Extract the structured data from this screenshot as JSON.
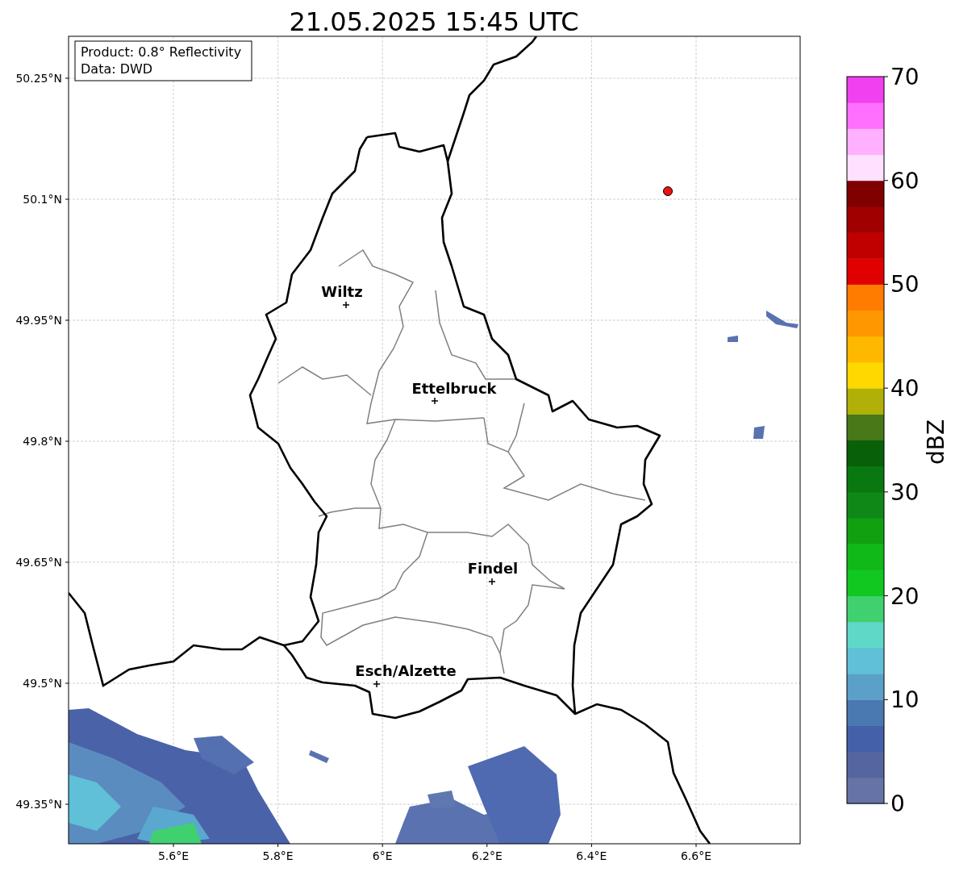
{
  "title": "21.05.2025 15:45 UTC",
  "info_box": {
    "lines": [
      "Product: 0.8° Reflectivity",
      "Data: DWD"
    ]
  },
  "map": {
    "y_ticks": [
      "50.25°N",
      "50.1°N",
      "49.95°N",
      "49.8°N",
      "49.65°N",
      "49.5°N",
      "49.35°N"
    ],
    "x_ticks": [
      "5.6°E",
      "5.8°E",
      "6°E",
      "6.2°E",
      "6.4°E",
      "6.6°E"
    ],
    "places": [
      {
        "name": "Wiltz"
      },
      {
        "name": "Ettelbruck"
      },
      {
        "name": "Findel"
      },
      {
        "name": "Esch/Alzette"
      }
    ]
  },
  "colorbar": {
    "label": "dBZ",
    "ticks": [
      "70",
      "60",
      "50",
      "40",
      "30",
      "20",
      "10",
      "0"
    ],
    "bands": [
      {
        "color": "#6673a6"
      },
      {
        "color": "#5565a0"
      },
      {
        "color": "#4460a8"
      },
      {
        "color": "#4a78b0"
      },
      {
        "color": "#5aa0c8"
      },
      {
        "color": "#60c0d8"
      },
      {
        "color": "#60d8c8"
      },
      {
        "color": "#40d070"
      },
      {
        "color": "#10c820"
      },
      {
        "color": "#10b818"
      },
      {
        "color": "#10a010"
      },
      {
        "color": "#108818"
      },
      {
        "color": "#0a7810"
      },
      {
        "color": "#086008"
      },
      {
        "color": "#487818"
      },
      {
        "color": "#b0b008"
      },
      {
        "color": "#ffd800"
      },
      {
        "color": "#ffb800"
      },
      {
        "color": "#ff9800"
      },
      {
        "color": "#ff7c00"
      },
      {
        "color": "#e00000"
      },
      {
        "color": "#c00000"
      },
      {
        "color": "#a00000"
      },
      {
        "color": "#800000"
      },
      {
        "color": "#ffe0ff"
      },
      {
        "color": "#ffb0ff"
      },
      {
        "color": "#ff70ff"
      },
      {
        "color": "#f040f0"
      }
    ]
  }
}
